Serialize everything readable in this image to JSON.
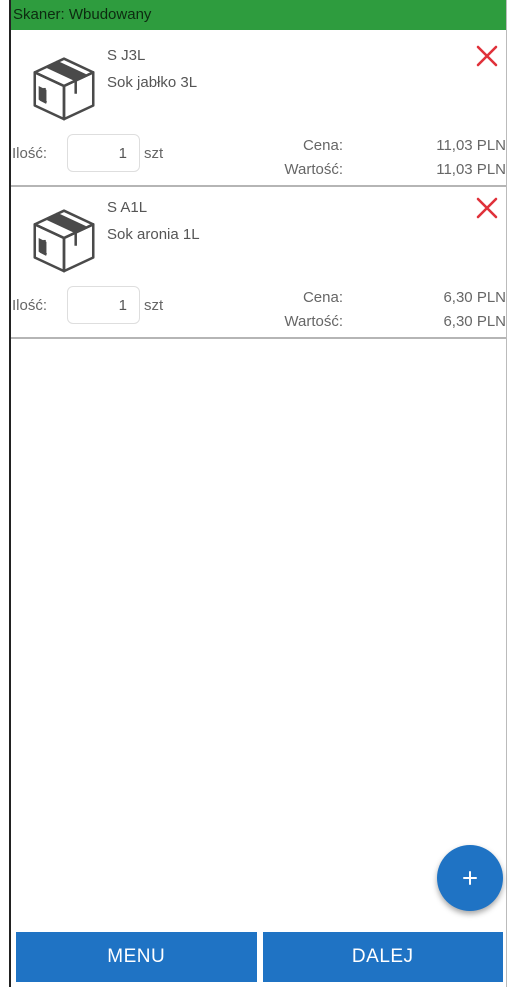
{
  "status_bar": {
    "scanner_text": "Skaner: Wbudowany"
  },
  "items": [
    {
      "code": "S J3L",
      "name": "Sok jabłko 3L",
      "qty_label": "Ilość:",
      "qty_value": "1",
      "unit": "szt",
      "price_label": "Cena:",
      "price_value": "11,03 PLN",
      "value_label": "Wartość:",
      "value_value": "11,03 PLN",
      "icon": "package-box-icon",
      "remove_icon": "close-icon"
    },
    {
      "code": "S A1L",
      "name": "Sok aronia 1L",
      "qty_label": "Ilość:",
      "qty_value": "1",
      "unit": "szt",
      "price_label": "Cena:",
      "price_value": "6,30 PLN",
      "value_label": "Wartość:",
      "value_value": "6,30 PLN",
      "icon": "package-box-icon",
      "remove_icon": "close-icon"
    }
  ],
  "fab": {
    "label": "+",
    "icon": "plus-icon"
  },
  "bottom_bar": {
    "menu_label": "MENU",
    "next_label": "DALEJ"
  },
  "colors": {
    "status_green": "#2e9c3e",
    "primary_blue": "#1f73c4",
    "remove_red": "#e0313a"
  }
}
